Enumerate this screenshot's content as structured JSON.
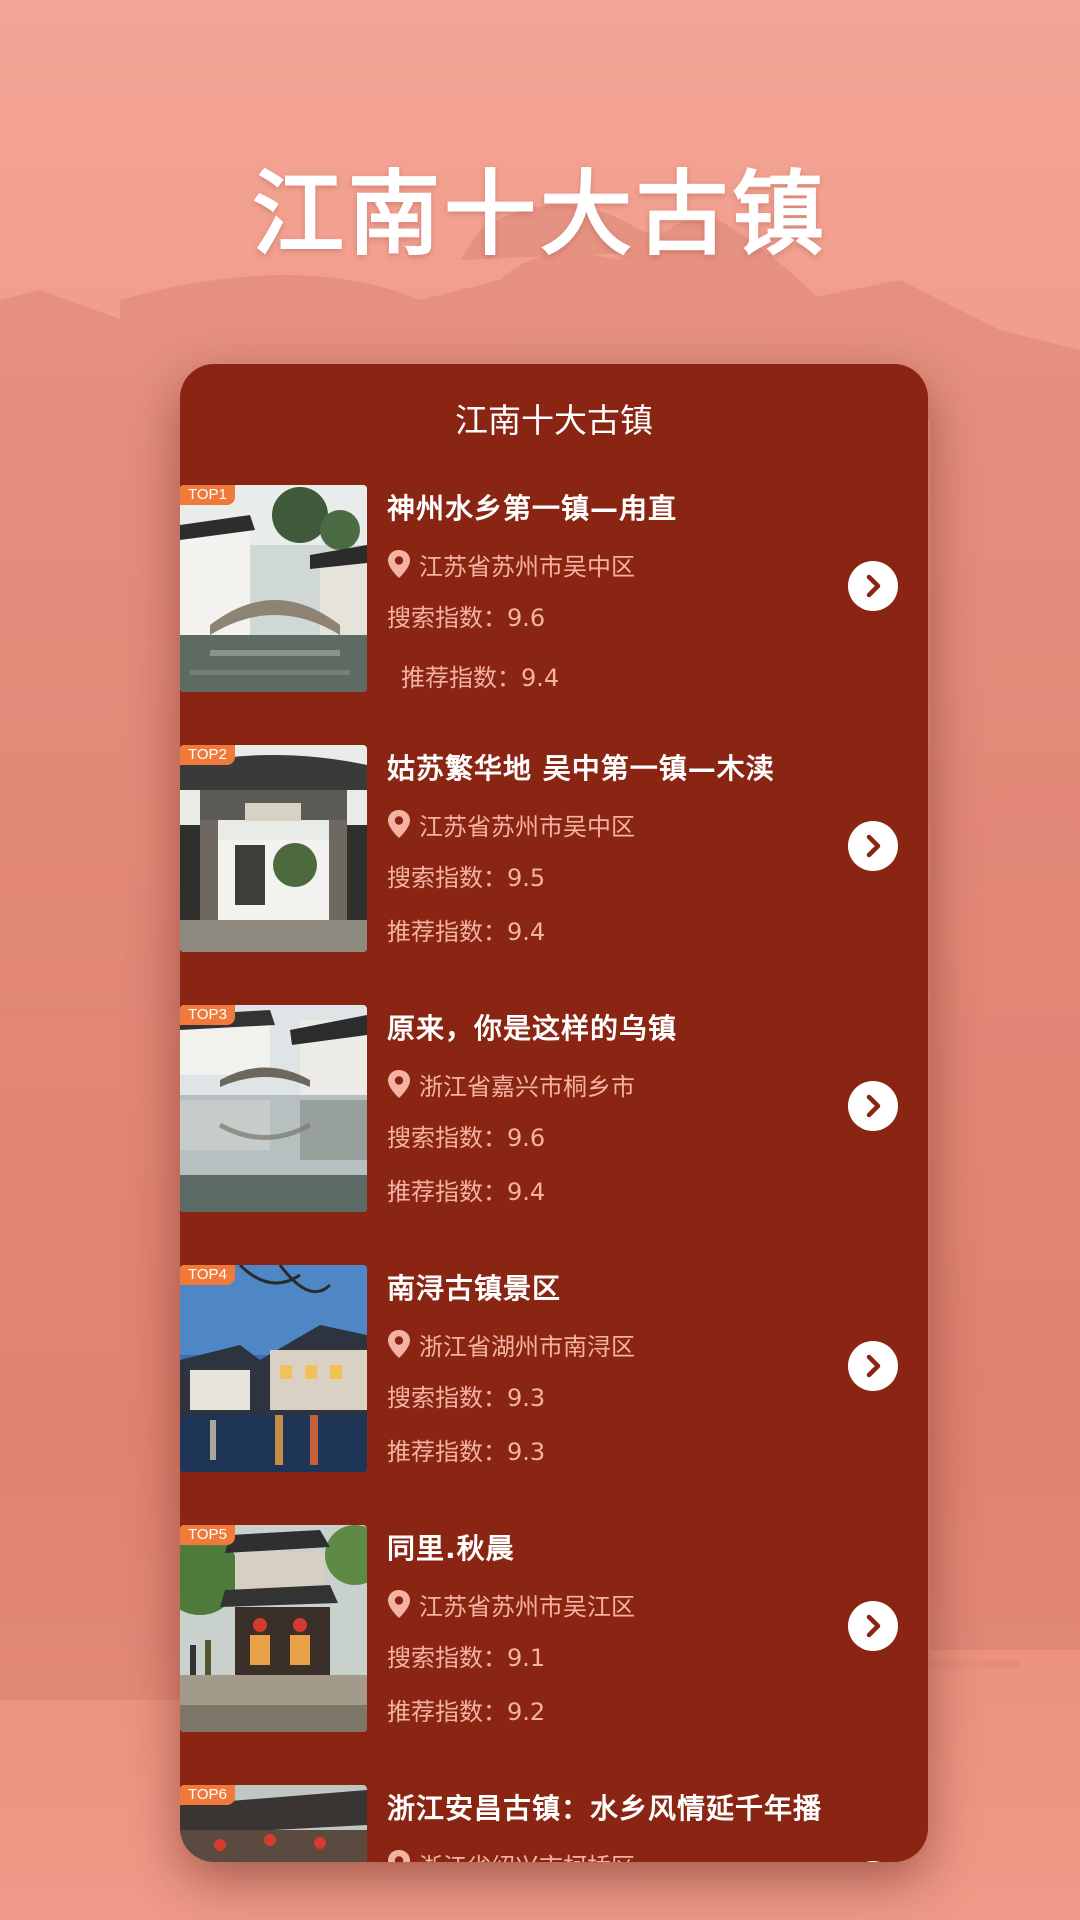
{
  "page": {
    "title": "江南十大古镇",
    "background_color": "#ee9a88"
  },
  "card": {
    "title": "江南十大古镇",
    "background_color": "#8a2513",
    "accent_color": "#f07a3a"
  },
  "towns": [
    {
      "rank": "TOP1",
      "name": "神州水乡第一镇—甪直",
      "location": "江苏省苏州市吴中区",
      "search_index": "搜索指数：9.6",
      "recommend_index": "推荐指数：9.4",
      "thumbnail_icon": "canal-bridge-photo"
    },
    {
      "rank": "TOP2",
      "name": "姑苏繁华地 吴中第一镇—木渎",
      "location": "江苏省苏州市吴中区",
      "search_index": "搜索指数：9.5",
      "recommend_index": "推荐指数：9.4",
      "thumbnail_icon": "archway-gate-photo"
    },
    {
      "rank": "TOP3",
      "name": "原来，你是这样的乌镇",
      "location": "浙江省嘉兴市桐乡市",
      "search_index": "搜索指数：9.6",
      "recommend_index": "推荐指数：9.4",
      "thumbnail_icon": "water-reflection-photo"
    },
    {
      "rank": "TOP4",
      "name": "南浔古镇景区",
      "location": "浙江省湖州市南浔区",
      "search_index": "搜索指数：9.3",
      "recommend_index": "推荐指数：9.3",
      "thumbnail_icon": "night-canal-photo"
    },
    {
      "rank": "TOP5",
      "name": "同里.秋晨",
      "location": "江苏省苏州市吴江区",
      "search_index": "搜索指数：9.1",
      "recommend_index": "推荐指数：9.2",
      "thumbnail_icon": "lantern-street-photo"
    },
    {
      "rank": "TOP6",
      "name": "浙江安昌古镇：水乡风情延千年播",
      "location": "浙江省绍兴市柯桥区",
      "search_index": "",
      "recommend_index": "",
      "thumbnail_icon": "market-street-photo"
    }
  ],
  "icons": {
    "location": "location-pin-icon",
    "detail": "chevron-right-icon"
  }
}
